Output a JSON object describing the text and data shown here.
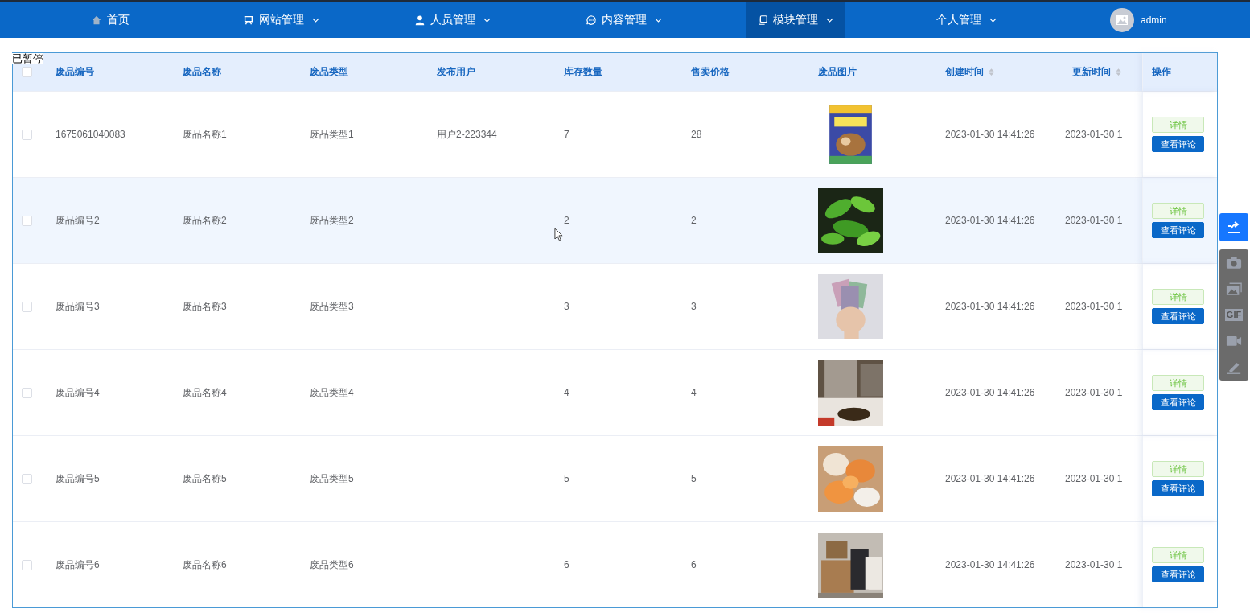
{
  "nav": {
    "items": [
      {
        "label": "首页",
        "dropdown": false,
        "selected": false
      },
      {
        "label": "网站管理",
        "dropdown": true,
        "selected": false
      },
      {
        "label": "人员管理",
        "dropdown": true,
        "selected": false
      },
      {
        "label": "内容管理",
        "dropdown": true,
        "selected": false
      },
      {
        "label": "模块管理",
        "dropdown": true,
        "selected": true
      },
      {
        "label": "个人管理",
        "dropdown": true,
        "selected": false
      }
    ],
    "user": {
      "name": "admin"
    }
  },
  "status_label": "已暂停",
  "table": {
    "all_checked": false,
    "columns": [
      {
        "label": "废品编号",
        "sortable": false
      },
      {
        "label": "废品名称",
        "sortable": false
      },
      {
        "label": "废品类型",
        "sortable": false
      },
      {
        "label": "发布用户",
        "sortable": false
      },
      {
        "label": "库存数量",
        "sortable": false
      },
      {
        "label": "售卖价格",
        "sortable": false
      },
      {
        "label": "废品图片",
        "sortable": false
      },
      {
        "label": "创建时间",
        "sortable": true
      },
      {
        "label": "更新时间",
        "sortable": true
      },
      {
        "label": "操作",
        "sortable": false
      }
    ],
    "rows": [
      {
        "checked": false,
        "hovered": false,
        "code": "1675061040083",
        "name": "废品名称1",
        "type": "废品类型1",
        "user": "用户2-223344",
        "stock": "7",
        "price": "28",
        "created": "2023-01-30 14:41:26",
        "updated": "2023-01-30 1",
        "actions": [
          "详情",
          "查看评论"
        ]
      },
      {
        "checked": false,
        "hovered": true,
        "code": "废品编号2",
        "name": "废品名称2",
        "type": "废品类型2",
        "stock": "2",
        "price": "2",
        "created": "2023-01-30 14:41:26",
        "updated": "2023-01-30 1",
        "actions": [
          "详情",
          "查看评论"
        ]
      },
      {
        "checked": false,
        "hovered": false,
        "code": "废品编号3",
        "name": "废品名称3",
        "type": "废品类型3",
        "stock": "3",
        "price": "3",
        "created": "2023-01-30 14:41:26",
        "updated": "2023-01-30 1",
        "actions": [
          "详情",
          "查看评论"
        ]
      },
      {
        "checked": false,
        "hovered": false,
        "code": "废品编号4",
        "name": "废品名称4",
        "type": "废品类型4",
        "stock": "4",
        "price": "4",
        "created": "2023-01-30 14:41:26",
        "updated": "2023-01-30 1",
        "actions": [
          "详情",
          "查看评论"
        ]
      },
      {
        "checked": false,
        "hovered": false,
        "code": "废品编号5",
        "name": "废品名称5",
        "type": "废品类型5",
        "stock": "5",
        "price": "5",
        "created": "2023-01-30 14:41:26",
        "updated": "2023-01-30 1",
        "actions": [
          "详情",
          "查看评论"
        ]
      },
      {
        "checked": false,
        "hovered": false,
        "code": "废品编号6",
        "name": "废品名称6",
        "type": "废品类型6",
        "stock": "6",
        "price": "6",
        "created": "2023-01-30 14:41:26",
        "updated": "2023-01-30 1",
        "actions": [
          "详情",
          "查看评论"
        ]
      }
    ]
  },
  "capture_toolbar": {
    "gif_label": "GIF"
  }
}
